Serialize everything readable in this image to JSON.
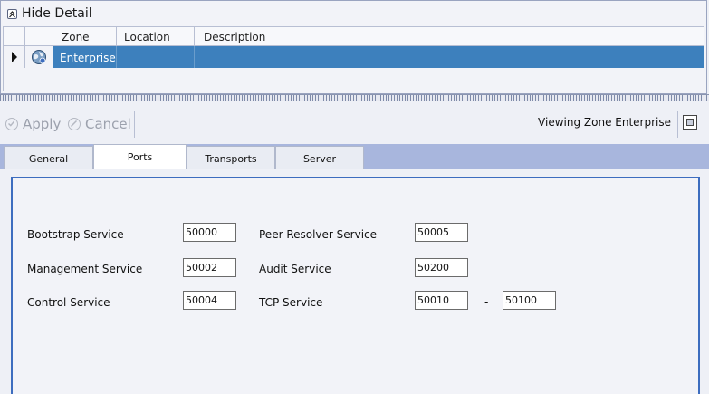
{
  "detail": {
    "hide_label": "Hide Detail",
    "columns": [
      "Zone",
      "Location",
      "Description"
    ],
    "rows": [
      {
        "zone": "Enterprise",
        "location": "",
        "description": ""
      }
    ]
  },
  "toolbar": {
    "apply_label": "Apply",
    "cancel_label": "Cancel",
    "viewing_text": "Viewing Zone Enterprise"
  },
  "tabs": [
    {
      "label": "General",
      "active": false
    },
    {
      "label": "Ports",
      "active": true
    },
    {
      "label": "Transports",
      "active": false
    },
    {
      "label": "Server",
      "active": false
    }
  ],
  "ports": {
    "bootstrap": {
      "label": "Bootstrap Service",
      "value": "50000"
    },
    "management": {
      "label": "Management Service",
      "value": "50002"
    },
    "control": {
      "label": "Control Service",
      "value": "50004"
    },
    "peer_resolver": {
      "label": "Peer Resolver Service",
      "value": "50005"
    },
    "audit": {
      "label": "Audit Service",
      "value": "50200"
    },
    "tcp": {
      "label": "TCP Service",
      "value_from": "50010",
      "separator": "-",
      "value_to": "50100"
    }
  },
  "colors": {
    "selection": "#3d80bd",
    "tab_strip": "#a8b6dd",
    "panel_border": "#3d6dbf"
  }
}
